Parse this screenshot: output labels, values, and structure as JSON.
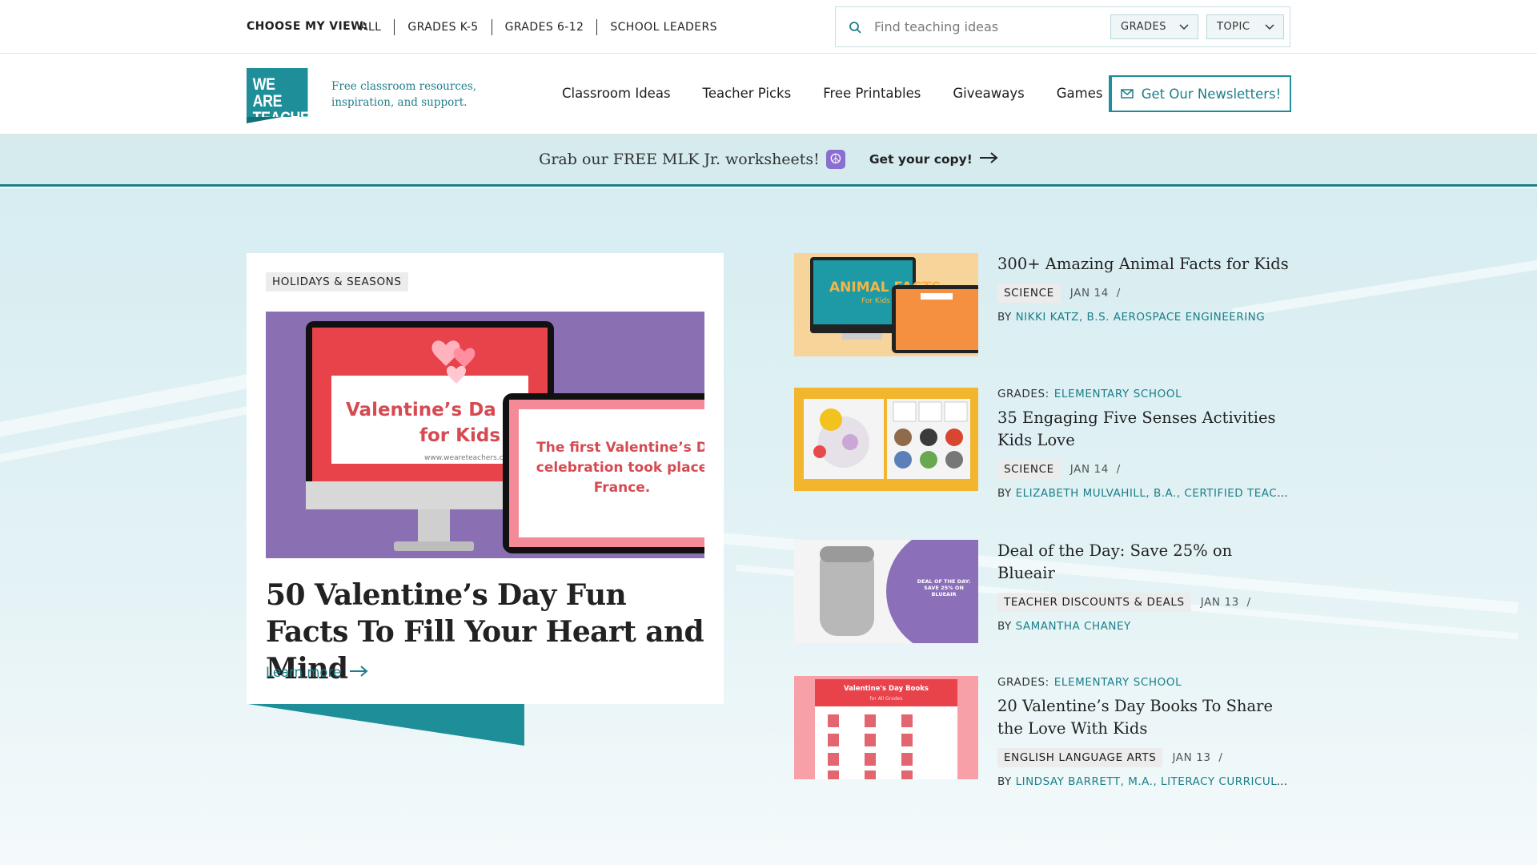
{
  "utility": {
    "view_label": "CHOOSE MY VIEW:",
    "views": [
      "ALL",
      "GRADES K-5",
      "GRADES 6-12",
      "SCHOOL LEADERS"
    ],
    "search_placeholder": "Find teaching ideas",
    "filters": {
      "grades": "GRADES",
      "topic": "TOPIC"
    }
  },
  "header": {
    "logo_line1": "WE ARE",
    "logo_line2": "TEACHERS",
    "tagline": "Free classroom resources, inspiration, and support.",
    "nav": [
      "Classroom Ideas",
      "Teacher Picks",
      "Free Printables",
      "Giveaways",
      "Games"
    ],
    "newsletter_label": "Get Our Newsletters!"
  },
  "promo": {
    "text": "Grab our FREE MLK Jr. worksheets!",
    "cta": "Get your copy!"
  },
  "feature": {
    "tag": "HOLIDAYS & SEASONS",
    "title": "50 Valentine’s Day Fun Facts To Fill Your Heart and Mind",
    "learn_more": "Learn more",
    "image": {
      "monitor_text_1": "Valentine’s Da",
      "monitor_text_2": "for Kids",
      "monitor_url": "www.weareteachers.com",
      "tablet_text": "The first Valentine’s D celebration took place France."
    }
  },
  "articles": [
    {
      "grade_label": "",
      "grade_value": "",
      "title": "300+ Amazing Animal Facts for Kids",
      "tag": "SCIENCE",
      "date": "JAN 14",
      "by": "BY",
      "author": "NIKKI KATZ, B.S. AEROSPACE ENGINEERING",
      "thumb_text": "ANIMAL FACTS",
      "thumb_sub": "For Kids"
    },
    {
      "grade_label": "GRADES:",
      "grade_value": "ELEMENTARY SCHOOL",
      "title": "35 Engaging Five Senses Activities Kids Love",
      "tag": "SCIENCE",
      "date": "JAN 14",
      "by": "BY",
      "author": "ELIZABETH MULVAHILL, B.A., CERTIFIED TEACH...",
      "thumb_text": "",
      "thumb_sub": ""
    },
    {
      "grade_label": "",
      "grade_value": "",
      "title": "Deal of the Day: Save 25% on Blueair",
      "tag": "TEACHER DISCOUNTS & DEALS",
      "date": "JAN 13",
      "by": "BY",
      "author": "SAMANTHA CHANEY",
      "thumb_text": "DEAL OF THE DAY: SAVE 25% ON BLUEAIR",
      "thumb_sub": ""
    },
    {
      "grade_label": "GRADES:",
      "grade_value": "ELEMENTARY SCHOOL",
      "title": "20 Valentine’s Day Books To Share the Love With Kids",
      "tag": "ENGLISH LANGUAGE ARTS",
      "date": "JAN 13",
      "by": "BY",
      "author": "LINDSAY BARRETT, M.A., LITERACY CURRICULU...",
      "thumb_text": "Valentine's Day Books",
      "thumb_sub": "for All Grades"
    }
  ],
  "colors": {
    "brand_teal": "#1e8e99",
    "link_teal": "#1a7f89",
    "promo_bg": "#d5ebee",
    "feature_purple": "#8b6fb3"
  }
}
